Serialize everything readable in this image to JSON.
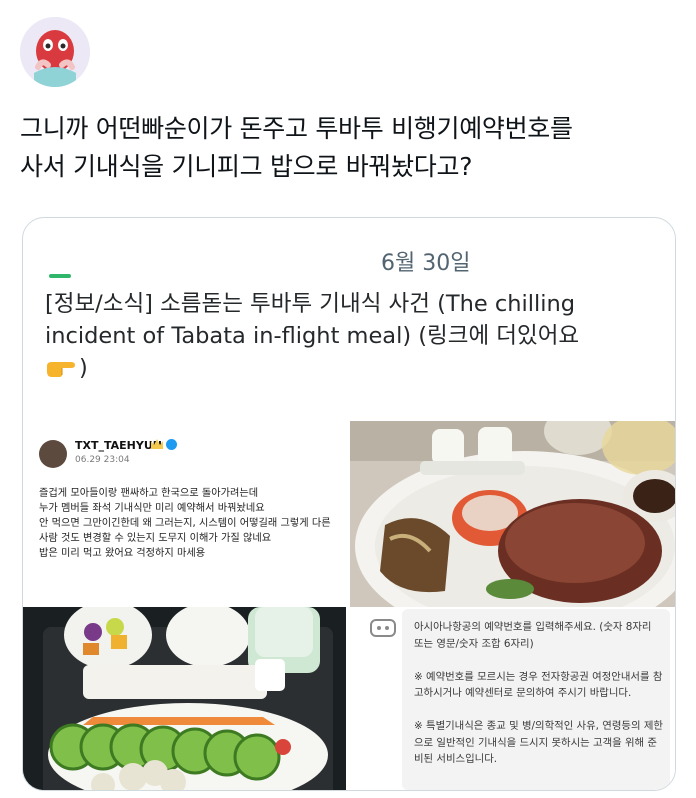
{
  "tweet": {
    "text": "그니까 어떤빠순이가 돈주고 투바투 비행기예약번호를\n사서 기내식을 기니피그 밥으로 바꿔놨다고?"
  },
  "card": {
    "date": "6월 30일",
    "headline": "[정보/소식] 소름돋는 투바투 기내식 사건 (The chilling incident of Tabata in-flight meal) (링크에 더있어요",
    "headline_tail": ")",
    "finger_icon": "pointing-finger-icon"
  },
  "quoted_tweet": {
    "name": "TXT_TAEHYUN",
    "date": "06.29 23:04",
    "body": "즐겁게 모아들이랑 팬싸하고 한국으로 돌아가려는데\n누가 멤버들 좌석 기내식만 미리 예약해서 바꿔놨네요\n안 먹으면 그만이긴한데 왜 그러는지, 시스템이 어떻길래 그렇게 다른 사람 것도 변경할 수 있는지 도무지 이해가 가질 않네요\n밥은 미리 먹고 왔어요 걱정하지 마세용"
  },
  "airline_chat": {
    "message": "아시아나항공의 예약번호를 입력해주세요. (숫자 8자리 또는 영문/숫자 조합 6자리)\n\n※ 예약번호를 모르시는 경우 전자항공권 여정안내서를 참고하시거나 예약센터로 문의하여 주시기 바랍니다.\n\n※ 특별기내식은 종교 및 병/의학적인 사유, 연령등의 제한으로 일반적인 기내식을 드시지 못하시는 고객을 위해 준비된 서비스입니다."
  },
  "colors": {
    "text": "#0f1419",
    "secondary": "#536471",
    "border": "#cfd9de",
    "accent_green": "#2fb66a",
    "verified": "#1d9bf0"
  }
}
